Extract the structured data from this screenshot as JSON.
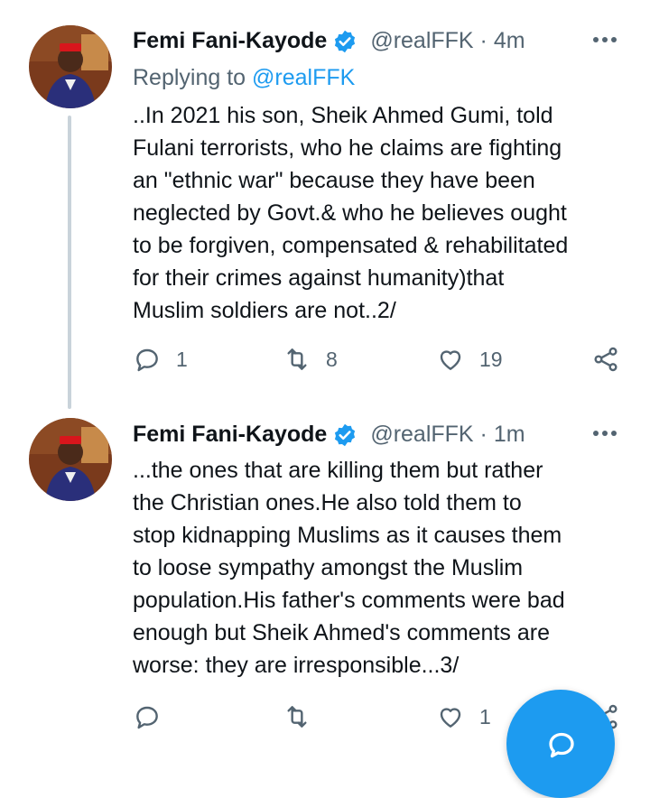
{
  "tweets": [
    {
      "name": "Femi Fani-Kayode",
      "handle": "@realFFK · 4m",
      "replying_prefix": "Replying to ",
      "replying_handle": "@realFFK",
      "text": "..In 2021 his son, Sheik Ahmed Gumi, told\nFulani terrorists, who he claims are fighting\nan \"ethnic war\" because they have been\nneglected by Govt.& who he believes ought\nto be forgiven, compensated & rehabilitated\nfor their crimes against humanity)that\nMuslim soldiers are not..2/",
      "replies": "1",
      "retweets": "8",
      "likes": "19"
    },
    {
      "name": "Femi Fani-Kayode",
      "handle": "@realFFK · 1m",
      "text": "...the ones that are killing them but rather\nthe Christian ones.He also told them to\nstop kidnapping Muslims as it causes them\nto loose sympathy amongst the Muslim\npopulation.His father's comments were bad\nenough but Sheik Ahmed's comments are\nworse: they are irresponsible...3/",
      "likes": "1"
    }
  ],
  "icons": {
    "verified": "verified-badge-icon",
    "more": "more-options-icon",
    "reply": "reply-icon",
    "retweet": "retweet-icon",
    "like": "heart-icon",
    "share": "share-icon",
    "compose": "compose-icon"
  },
  "colors": {
    "accent": "#1d9bf0",
    "muted": "#536471",
    "thread_line": "#c9d3da"
  }
}
